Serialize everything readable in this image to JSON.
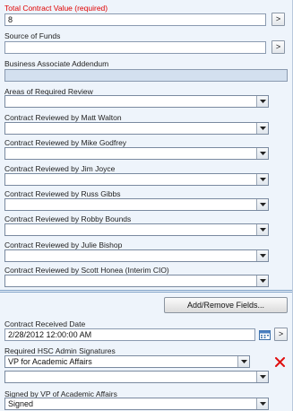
{
  "fields": {
    "total_contract_value": {
      "label": "Total Contract Value (required)",
      "value": "8",
      "go": ">"
    },
    "source_of_funds": {
      "label": "Source of Funds",
      "value": "",
      "go": ">"
    },
    "baa": {
      "label": "Business Associate Addendum",
      "value": ""
    },
    "areas_review": {
      "label": "Areas of Required Review",
      "value": ""
    },
    "rev_walton": {
      "label": "Contract Reviewed by Matt Walton",
      "value": ""
    },
    "rev_godfrey": {
      "label": "Contract Reviewed by Mike Godfrey",
      "value": ""
    },
    "rev_joyce": {
      "label": "Contract Reviewed by Jim Joyce",
      "value": ""
    },
    "rev_gibbs": {
      "label": "Contract Reviewed by Russ Gibbs",
      "value": ""
    },
    "rev_bounds": {
      "label": "Contract Reviewed by Robby Bounds",
      "value": ""
    },
    "rev_bishop": {
      "label": "Contract Reviewed by Julie Bishop",
      "value": ""
    },
    "rev_honea": {
      "label": "Contract Reviewed by Scott Honea (Interim CIO)",
      "value": ""
    }
  },
  "toolbar": {
    "add_remove_label": "Add/Remove Fields..."
  },
  "lower": {
    "received_date": {
      "label": "Contract Received Date",
      "value": "2/28/2012 12:00:00 AM",
      "go": ">"
    },
    "signatures": {
      "label": "Required HSC Admin Signatures",
      "value1": "VP for Academic Affairs",
      "value2": ""
    },
    "signed_by": {
      "label": "Signed by VP of Academic Affairs",
      "value": "Signed"
    }
  },
  "icons": {
    "calendar": "calendar-icon",
    "delete": "red-x-delete-icon",
    "dropdown": "chevron-down-icon"
  },
  "colors": {
    "required_label": "#e00000",
    "panel_bg": "#eef4fb",
    "disabled_field": "#d3e0ef"
  }
}
